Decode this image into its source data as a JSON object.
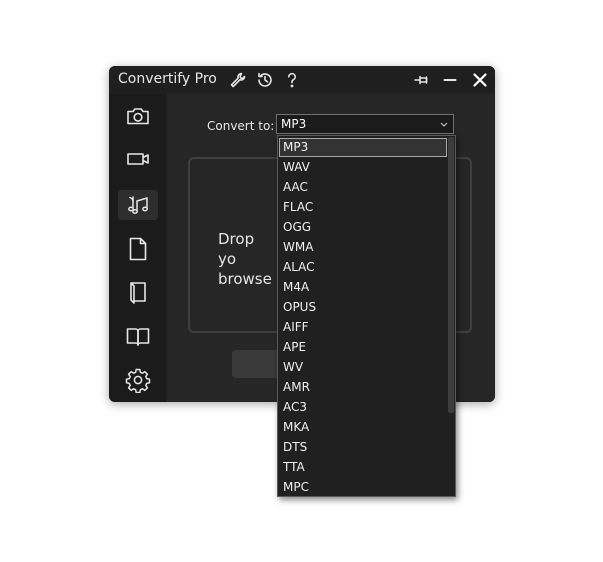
{
  "app": {
    "title": "Convertify Pro",
    "titlebar_icons": [
      "wrench-icon",
      "history-icon",
      "help-icon",
      "pin-icon",
      "minimize-icon",
      "close-icon"
    ]
  },
  "sidebar": {
    "items": [
      {
        "icon": "camera-icon",
        "name": "image"
      },
      {
        "icon": "video-camera-icon",
        "name": "video"
      },
      {
        "icon": "music-notes-icon",
        "name": "audio",
        "active": true
      },
      {
        "icon": "document-icon",
        "name": "document"
      },
      {
        "icon": "ebook-icon",
        "name": "ebook"
      },
      {
        "icon": "book-open-icon",
        "name": "book"
      },
      {
        "icon": "gear-icon",
        "name": "settings"
      }
    ]
  },
  "main": {
    "convert_label": "Convert to:",
    "selected_format": "MP3",
    "drop_text": "Drop yo\nbrowse"
  },
  "dropdown": {
    "options": [
      "MP3",
      "WAV",
      "AAC",
      "FLAC",
      "OGG",
      "WMA",
      "ALAC",
      "M4A",
      "OPUS",
      "AIFF",
      "APE",
      "WV",
      "AMR",
      "AC3",
      "MKA",
      "DTS",
      "TTA",
      "MPC"
    ],
    "selected": "MP3"
  },
  "colors": {
    "window_bg": "#1f1f1f",
    "sidebar_bg": "#1b1b1b",
    "main_bg": "#262626",
    "icon": "#e6e6e6"
  }
}
